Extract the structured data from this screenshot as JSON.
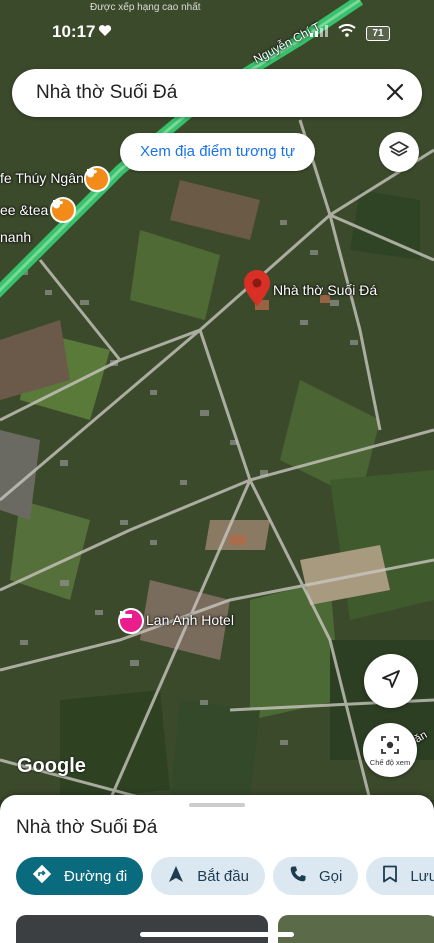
{
  "status": {
    "time": "10:17",
    "battery": "71",
    "top_text": "Được xếp hạng cao nhất"
  },
  "search": {
    "query": "Nhà thờ Suối Đá"
  },
  "similar_button": "Xem địa điểm tương tự",
  "map_labels": {
    "pin": "Nhà thờ Suối Đá",
    "road": "Nguyễn Chí T",
    "cafe1": "fe Thúy Ngân",
    "cafe2": "ee &tea",
    "cafe3": "nanh",
    "hotel": "Lan Anh Hotel",
    "edge": "Văn"
  },
  "view_mode_label": "Chế độ xem",
  "google_logo": "Google",
  "sheet": {
    "title": "Nhà thờ Suối Đá",
    "actions": [
      {
        "label": "Đường đi",
        "icon": "directions-icon"
      },
      {
        "label": "Bắt đầu",
        "icon": "navigation-arrow-icon"
      },
      {
        "label": "Gọi",
        "icon": "phone-icon"
      },
      {
        "label": "Lưu",
        "icon": "bookmark-icon"
      }
    ]
  },
  "colors": {
    "accent": "#1a73e8",
    "primary_chip": "#0a6b7e",
    "chip": "#dbe8f2",
    "pin": "#d93025",
    "road": "#37c26b",
    "hotel": "#e91e8c",
    "cafe": "#f28b18"
  }
}
